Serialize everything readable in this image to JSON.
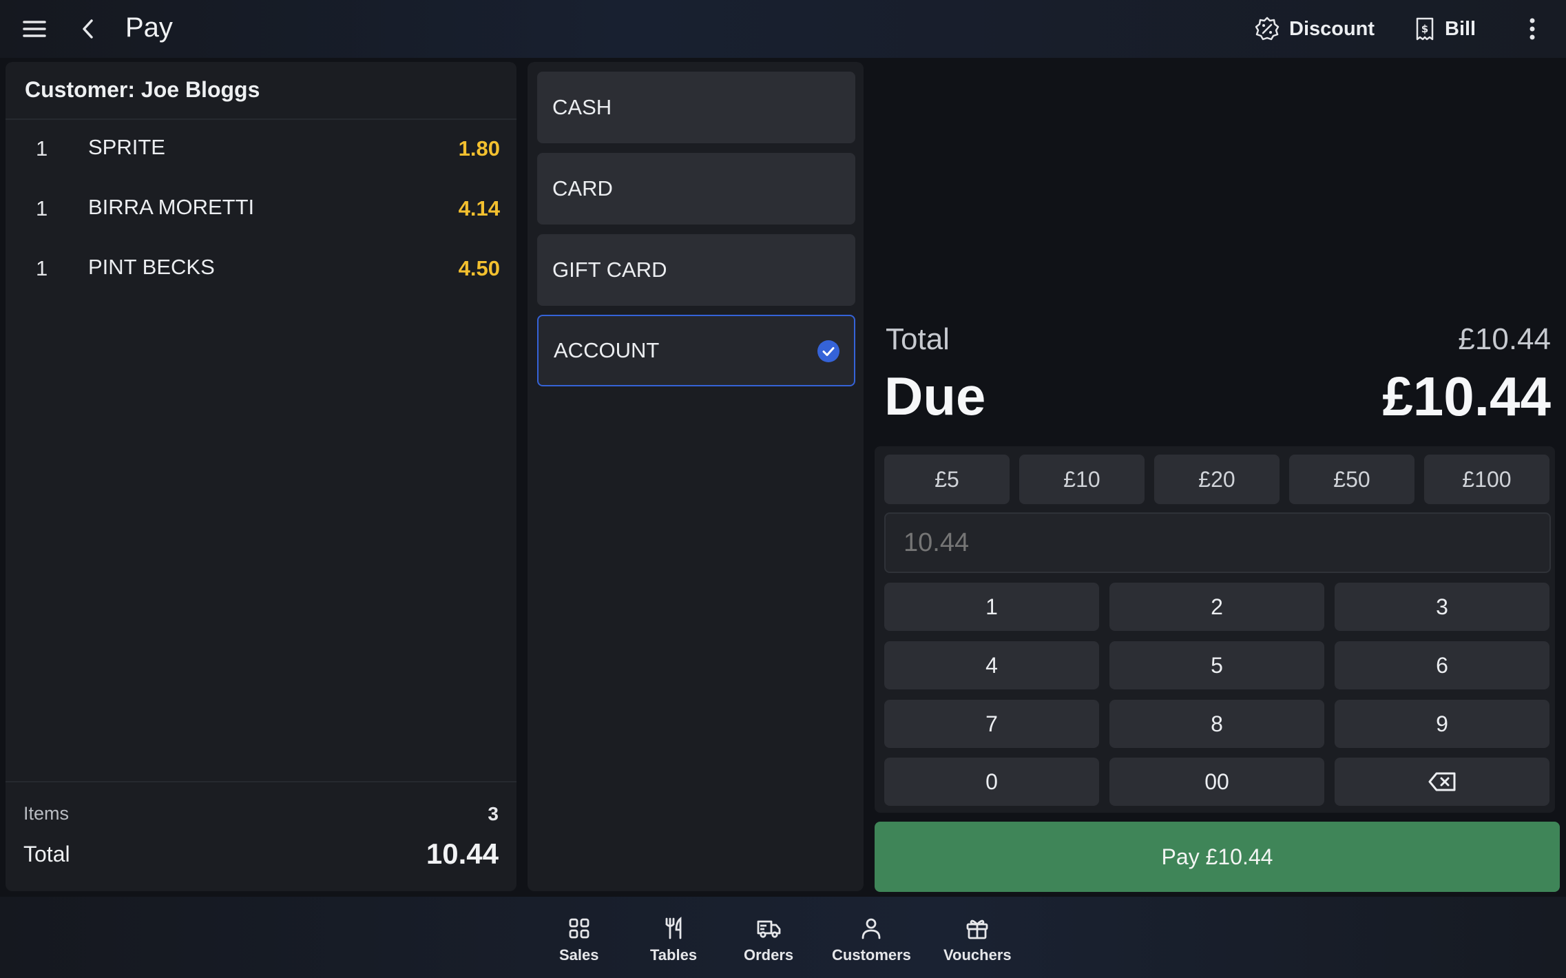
{
  "header": {
    "title": "Pay",
    "discount_label": "Discount",
    "bill_label": "Bill"
  },
  "order": {
    "customer_heading": "Customer: Joe Bloggs",
    "lines": [
      {
        "qty": "1",
        "name": "SPRITE",
        "price": "1.80"
      },
      {
        "qty": "1",
        "name": "BIRRA MORETTI",
        "price": "4.14"
      },
      {
        "qty": "1",
        "name": "PINT BECKS",
        "price": "4.50"
      }
    ],
    "items_label": "Items",
    "items_count": "3",
    "total_label": "Total",
    "total_value": "10.44"
  },
  "payment_methods": [
    {
      "label": "CASH",
      "selected": false
    },
    {
      "label": "CARD",
      "selected": false
    },
    {
      "label": "GIFT CARD",
      "selected": false
    },
    {
      "label": "ACCOUNT",
      "selected": true
    }
  ],
  "summary": {
    "total_label": "Total",
    "total_value": "£10.44",
    "due_label": "Due",
    "due_value": "£10.44"
  },
  "quick_amounts": [
    "£5",
    "£10",
    "£20",
    "£50",
    "£100"
  ],
  "amount_input": {
    "placeholder": "10.44"
  },
  "keypad": [
    "1",
    "2",
    "3",
    "4",
    "5",
    "6",
    "7",
    "8",
    "9",
    "0",
    "00"
  ],
  "pay_button_label": "Pay £10.44",
  "nav": {
    "sales": "Sales",
    "tables": "Tables",
    "orders": "Orders",
    "customers": "Customers",
    "vouchers": "Vouchers"
  },
  "colors": {
    "accent": "#3563d8",
    "price": "#f3c02f",
    "pay": "#3f8558"
  }
}
